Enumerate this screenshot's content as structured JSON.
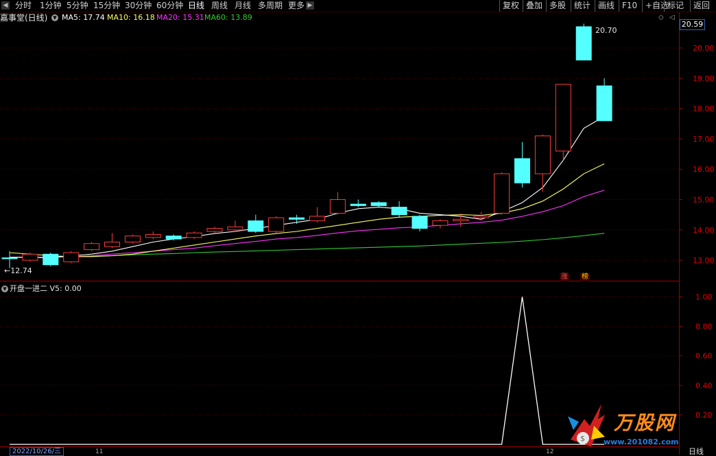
{
  "toolbar": {
    "timeframes": [
      "分时",
      "1分钟",
      "5分钟",
      "15分钟",
      "30分钟",
      "60分钟",
      "日线",
      "周线",
      "月线",
      "多周期",
      "更多"
    ],
    "active_timeframe": "日线",
    "right_buttons": [
      "复权",
      "叠加",
      "多股",
      "统计",
      "画线",
      "F10",
      "+自选",
      "返回"
    ],
    "arrow_left": "◀",
    "arrow_right": "▶"
  },
  "main_chart": {
    "title": "嘉事堂(日线)",
    "ma5_label": "MA5: 17.74",
    "ma10_label": "MA10: 16.18",
    "ma20_label": "MA20: 15.31",
    "ma60_label": "MA60: 13.89",
    "last_price_tag": "20.59",
    "high_label": "20.70",
    "low_label": "←12.74",
    "mark_zhang": "涨",
    "mark_bang": "榜",
    "y_ticks": [
      "20.00",
      "19.00",
      "18.00",
      "17.00",
      "16.00",
      "15.00",
      "14.00",
      "13.00"
    ]
  },
  "sub_chart": {
    "title": "开盘一进二  V5: 0.00",
    "y_ticks": [
      "1.00",
      "0.80",
      "0.60",
      "0.40",
      "0.20"
    ]
  },
  "bottom": {
    "date": "2022/10/26/三",
    "period": "日线",
    "tick_11": "11",
    "tick_12": "12"
  },
  "sidebar_right": {
    "label": "标记"
  },
  "logo": {
    "text": "万股网",
    "url": "www.201082.com"
  },
  "colors": {
    "up": "#ff3b3b",
    "down": "#54ffff",
    "ma5": "#ffffff",
    "ma10": "#ffff66",
    "ma20": "#ff33ff",
    "ma60": "#33cc33",
    "axis": "#8b0000"
  },
  "chart_data": {
    "type": "candlestick",
    "y_range": [
      12.55,
      21.05
    ],
    "candles": [
      {
        "o": 13.08,
        "c": 13.05,
        "h": 13.3,
        "l": 12.74
      },
      {
        "o": 13.0,
        "c": 13.2,
        "h": 13.25,
        "l": 12.95
      },
      {
        "o": 13.2,
        "c": 12.85,
        "h": 13.25,
        "l": 12.8
      },
      {
        "o": 12.95,
        "c": 13.25,
        "h": 13.3,
        "l": 12.9
      },
      {
        "o": 13.35,
        "c": 13.55,
        "h": 13.6,
        "l": 13.3
      },
      {
        "o": 13.45,
        "c": 13.6,
        "h": 13.9,
        "l": 13.4
      },
      {
        "o": 13.6,
        "c": 13.8,
        "h": 13.85,
        "l": 13.55
      },
      {
        "o": 13.75,
        "c": 13.85,
        "h": 13.95,
        "l": 13.7
      },
      {
        "o": 13.8,
        "c": 13.7,
        "h": 13.85,
        "l": 13.65
      },
      {
        "o": 13.75,
        "c": 13.9,
        "h": 13.95,
        "l": 13.7
      },
      {
        "o": 13.95,
        "c": 14.05,
        "h": 14.1,
        "l": 13.9
      },
      {
        "o": 14.0,
        "c": 14.1,
        "h": 14.3,
        "l": 13.95
      },
      {
        "o": 14.3,
        "c": 13.95,
        "h": 14.5,
        "l": 13.9
      },
      {
        "o": 13.95,
        "c": 14.4,
        "h": 14.45,
        "l": 13.9
      },
      {
        "o": 14.4,
        "c": 14.35,
        "h": 14.5,
        "l": 14.2
      },
      {
        "o": 14.3,
        "c": 14.45,
        "h": 14.75,
        "l": 14.25
      },
      {
        "o": 14.55,
        "c": 15.0,
        "h": 15.25,
        "l": 14.5
      },
      {
        "o": 14.85,
        "c": 14.8,
        "h": 15.0,
        "l": 14.75
      },
      {
        "o": 14.9,
        "c": 14.8,
        "h": 14.95,
        "l": 14.75
      },
      {
        "o": 14.75,
        "c": 14.5,
        "h": 14.95,
        "l": 14.4
      },
      {
        "o": 14.45,
        "c": 14.05,
        "h": 14.5,
        "l": 13.95
      },
      {
        "o": 14.15,
        "c": 14.3,
        "h": 14.35,
        "l": 14.05
      },
      {
        "o": 14.3,
        "c": 14.35,
        "h": 14.55,
        "l": 14.1
      },
      {
        "o": 14.4,
        "c": 14.45,
        "h": 14.6,
        "l": 14.3
      },
      {
        "o": 14.55,
        "c": 15.85,
        "h": 15.9,
        "l": 14.5
      },
      {
        "o": 16.35,
        "c": 15.55,
        "h": 16.9,
        "l": 15.4
      },
      {
        "o": 15.85,
        "c": 17.1,
        "h": 17.15,
        "l": 15.25
      },
      {
        "o": 16.6,
        "c": 18.8,
        "h": 18.8,
        "l": 16.3
      },
      {
        "o": 20.7,
        "c": 19.6,
        "h": 20.8,
        "l": 19.6
      },
      {
        "o": 18.75,
        "c": 17.6,
        "h": 19.0,
        "l": 17.6
      }
    ],
    "ma5": [
      13.1,
      13.1,
      13.08,
      13.15,
      13.2,
      13.3,
      13.45,
      13.6,
      13.7,
      13.78,
      13.88,
      13.95,
      14.05,
      14.15,
      14.25,
      14.35,
      14.55,
      14.7,
      14.75,
      14.7,
      14.55,
      14.5,
      14.45,
      14.35,
      14.6,
      14.9,
      15.4,
      16.3,
      17.35,
      17.74
    ],
    "ma10": [
      13.25,
      13.2,
      13.15,
      13.12,
      13.12,
      13.15,
      13.2,
      13.3,
      13.4,
      13.5,
      13.6,
      13.7,
      13.8,
      13.88,
      13.95,
      14.05,
      14.15,
      14.25,
      14.35,
      14.42,
      14.45,
      14.48,
      14.5,
      14.48,
      14.55,
      14.7,
      14.95,
      15.35,
      15.85,
      16.18
    ],
    "ma20": [
      13.1,
      13.1,
      13.1,
      13.12,
      13.15,
      13.2,
      13.25,
      13.3,
      13.35,
      13.4,
      13.48,
      13.55,
      13.62,
      13.7,
      13.75,
      13.82,
      13.9,
      13.97,
      14.02,
      14.07,
      14.1,
      14.15,
      14.2,
      14.25,
      14.32,
      14.45,
      14.6,
      14.8,
      15.1,
      15.31
    ],
    "ma60": [
      13.1,
      13.1,
      13.1,
      13.12,
      13.13,
      13.15,
      13.18,
      13.2,
      13.22,
      13.25,
      13.27,
      13.29,
      13.31,
      13.33,
      13.35,
      13.37,
      13.39,
      13.41,
      13.43,
      13.45,
      13.47,
      13.5,
      13.53,
      13.56,
      13.59,
      13.63,
      13.68,
      13.74,
      13.81,
      13.89
    ],
    "sub_y_range": [
      0,
      1.05
    ],
    "signal": [
      0,
      0,
      0,
      0,
      0,
      0,
      0,
      0,
      0,
      0,
      0,
      0,
      0,
      0,
      0,
      0,
      0,
      0,
      0,
      0,
      0,
      0,
      0,
      0,
      0,
      1,
      0,
      0,
      0,
      0
    ]
  }
}
